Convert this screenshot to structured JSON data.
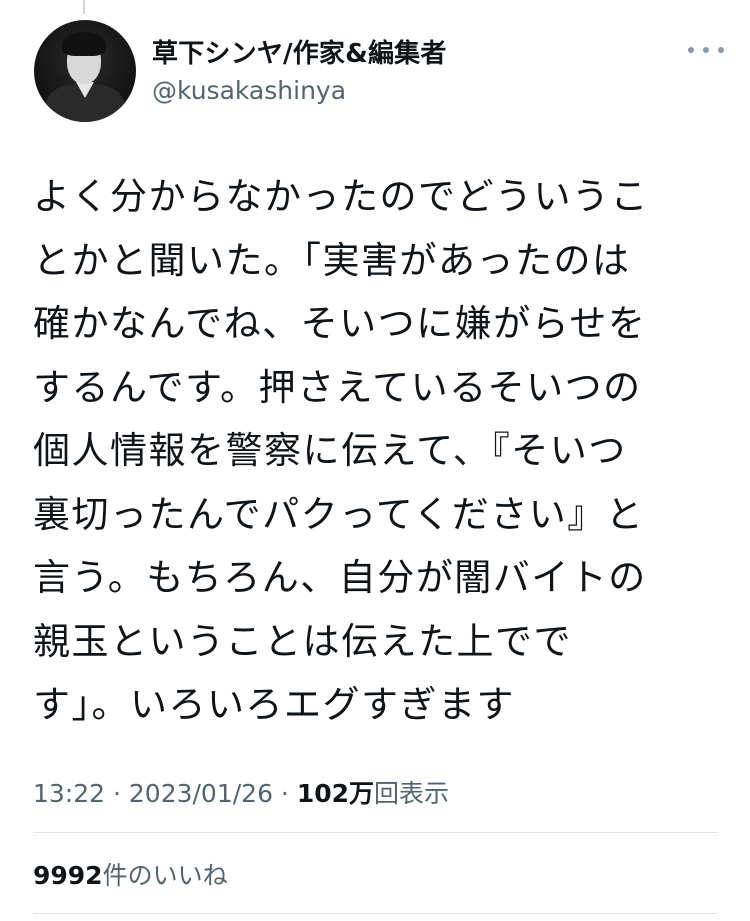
{
  "tweet": {
    "author": {
      "display_name": "草下シンヤ/作家&編集者",
      "handle": "@kusakashinya"
    },
    "more_icon": "more-horizontal-icon",
    "text_lines": [
      "よく分からなかったのでどういうこ",
      "とかと聞いた。「実害があったのは",
      "確かなんでね、そいつに嫌がらせを",
      "するんです。押さえているそいつの",
      "個人情報を警察に伝えて、『そいつ",
      "裏切ったんでパクってください』と",
      "言う。もちろん、自分が闇バイトの",
      "親玉ということは伝えた上でで",
      "す」。いろいろエグすぎます"
    ],
    "meta": {
      "time": "13:22",
      "separator_1": " · ",
      "date": "2023/01/26",
      "separator_2": " · ",
      "views_count": "102万",
      "views_label": "回表示"
    },
    "likes": {
      "count": "9992",
      "label": "件のいいね"
    }
  }
}
